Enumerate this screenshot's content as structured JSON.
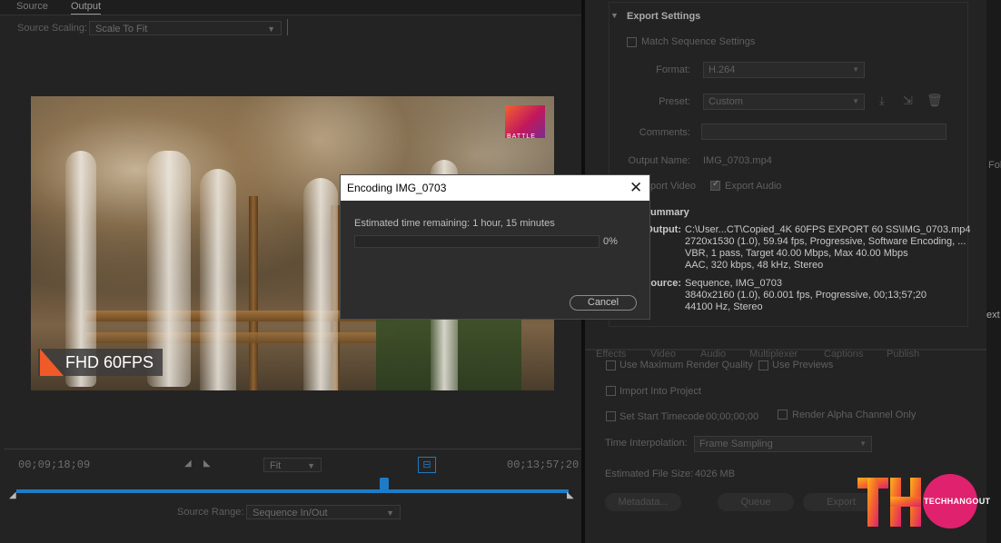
{
  "source_monitor": {
    "tabs": [
      "Source",
      "Output"
    ],
    "active_tab": "Output",
    "source_scaling_label": "Source Scaling:",
    "source_scaling_value": "Scale To Fit",
    "overlay_badge": "FHD 60FPS",
    "logo_text": "BATTLE",
    "current_time": "00;09;18;09",
    "fit_value": "Fit",
    "duration": "00;13;57;20",
    "source_range_label": "Source Range:",
    "source_range_value": "Sequence In/Out"
  },
  "export_settings": {
    "header": "Export Settings",
    "match_sequence": "Match Sequence Settings",
    "format_label": "Format:",
    "format_value": "H.264",
    "preset_label": "Preset:",
    "preset_value": "Custom",
    "comments_label": "Comments:",
    "output_name_label": "Output Name:",
    "output_name_value": "IMG_0703.mp4",
    "export_video": "port Video",
    "export_audio": "Export Audio",
    "summary_header": "ummary",
    "summary_output_label": "Output:",
    "summary_output_lines": [
      "C:\\User...CT\\Copied_4K 60FPS EXPORT 60 SS\\IMG_0703.mp4",
      "2720x1530 (1.0), 59.94 fps, Progressive, Software Encoding, ...",
      "VBR, 1 pass, Target 40.00 Mbps, Max 40.00 Mbps",
      "AAC, 320 kbps, 48 kHz, Stereo"
    ],
    "summary_source_label": "Source:",
    "summary_source_lines": [
      "Sequence, IMG_0703",
      "3840x2160 (1.0), 60.001 fps, Progressive, 00;13;57;20",
      "44100 Hz, Stereo"
    ],
    "tabs": [
      "Effects",
      "Video",
      "Audio",
      "Multiplexer",
      "Captions",
      "Publish"
    ],
    "use_max_render": "Use Maximum Render Quality",
    "use_previews": "Use Previews",
    "import_into_project": "Import Into Project",
    "set_start_timecode": "Set Start Timecode",
    "start_timecode_value": "00;00;00;00",
    "render_alpha": "Render Alpha Channel Only",
    "time_interp_label": "Time Interpolation:",
    "time_interp_value": "Frame Sampling",
    "est_size_label": "Estimated File Size:",
    "est_size_value": "4026 MB",
    "metadata_button": "Metadata...",
    "queue_button": "Queue",
    "export_button": "Export"
  },
  "edge_text": {
    "fol": "Fol",
    "ext": "ext"
  },
  "dialog": {
    "title": "Encoding IMG_0703",
    "estimated": "Estimated time remaining: 1 hour, 15 minutes",
    "progress_percent": "0%",
    "progress_value": 0,
    "cancel": "Cancel"
  },
  "brand": {
    "mark": "THO",
    "name": "TECHHANGOUT"
  },
  "colors": {
    "accent": "#1e7bc6",
    "brand_orange": "#f2622e",
    "brand_pink": "#e0216e"
  }
}
